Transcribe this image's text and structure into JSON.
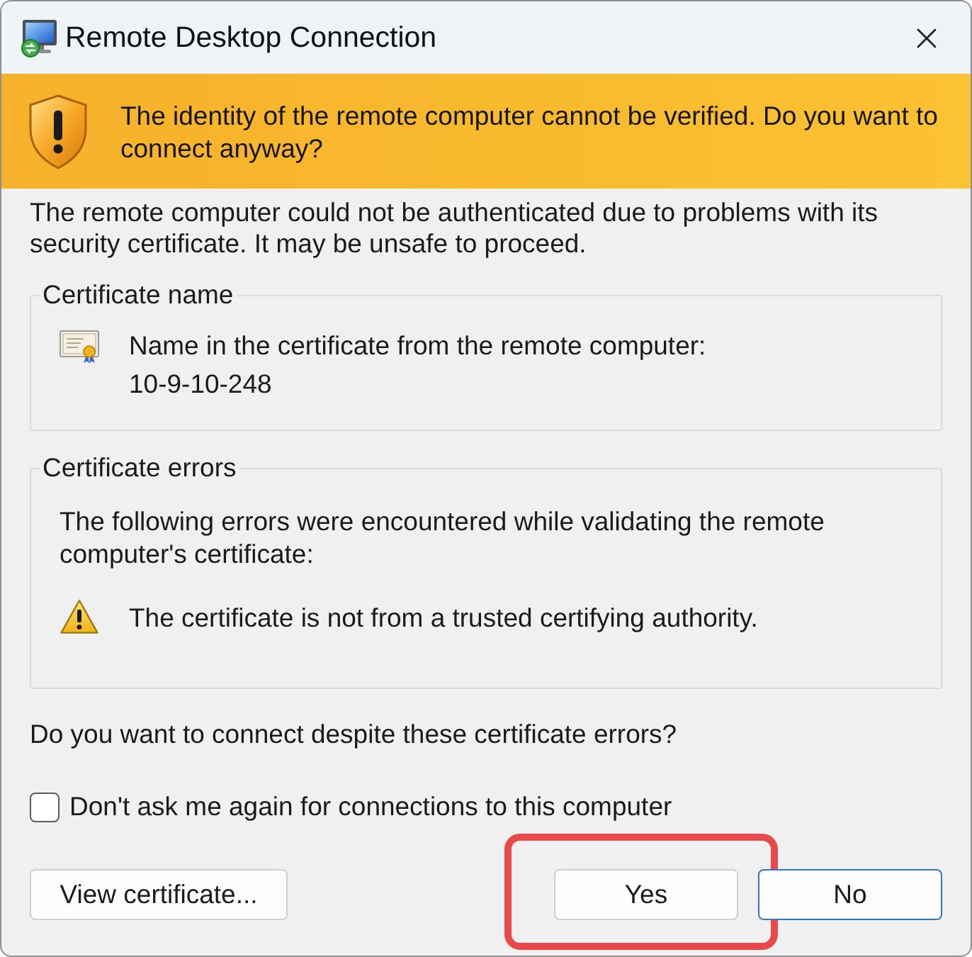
{
  "window": {
    "title": "Remote Desktop Connection"
  },
  "banner": {
    "message": "The identity of the remote computer cannot be verified. Do you want to connect anyway?"
  },
  "description": "The remote computer could not be authenticated due to problems with its security certificate. It may be unsafe to proceed.",
  "certificate_name": {
    "title": "Certificate name",
    "label": "Name in the certificate from the remote computer:",
    "value": "10-9-10-248"
  },
  "certificate_errors": {
    "title": "Certificate errors",
    "intro": "The following errors were encountered while validating the remote computer's certificate:",
    "errors": [
      "The certificate is not from a trusted certifying authority."
    ]
  },
  "question": "Do you want to connect despite these certificate errors?",
  "checkbox": {
    "label": "Don't ask me again for connections to this computer",
    "checked": false
  },
  "button_bar": {
    "left": [
      {
        "label": "View certificate...",
        "default": false,
        "highlighted": false
      }
    ],
    "right": [
      {
        "label": "Yes",
        "default": false,
        "highlighted": true
      },
      {
        "label": "No",
        "default": true,
        "highlighted": false
      }
    ]
  }
}
